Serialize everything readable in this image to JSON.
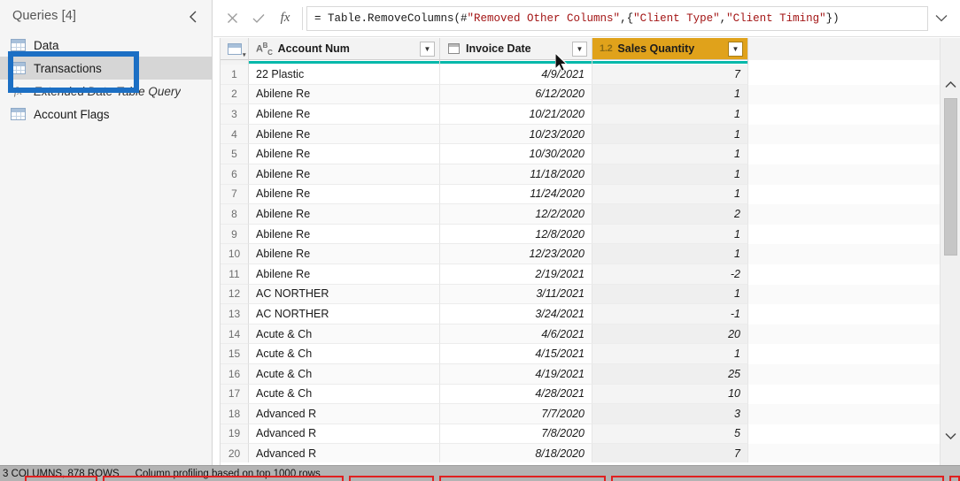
{
  "sidebar": {
    "title": "Queries [4]",
    "collapse_icon": "chevron-left-icon",
    "items": [
      {
        "label": "Data",
        "icon": "table-icon",
        "italic": false,
        "selected": false
      },
      {
        "label": "Transactions",
        "icon": "table-icon",
        "italic": false,
        "selected": true
      },
      {
        "label": "Extended Date Table Query",
        "icon": "fx-icon",
        "italic": true,
        "selected": false
      },
      {
        "label": "Account Flags",
        "icon": "table-icon",
        "italic": false,
        "selected": false
      }
    ]
  },
  "formula_bar": {
    "cancel_icon": "close-icon",
    "commit_icon": "check-icon",
    "fx_icon": "fx-icon",
    "expand_icon": "chevron-down-icon",
    "formula_prefix": "= Table.RemoveColumns(#",
    "formula_str1": "\"Removed Other Columns\"",
    "formula_mid": ",{",
    "formula_str2": "\"Client Type\"",
    "formula_comma": ", ",
    "formula_str3": "\"Client Timing\"",
    "formula_suffix": "})",
    "formula_full": "= Table.RemoveColumns(#\"Removed Other Columns\",{\"Client Type\", \"Client Timing\"})"
  },
  "grid": {
    "corner_icon": "table-select-all-icon",
    "columns": [
      {
        "name": "Account Num",
        "type_icon": "abc-text-type-icon",
        "type_label": "ABC",
        "selected": false
      },
      {
        "name": "Invoice Date",
        "type_icon": "calendar-date-type-icon",
        "type_label": "",
        "selected": false
      },
      {
        "name": "Sales Quantity",
        "type_icon": "decimal-number-type-icon",
        "type_label": "1.2",
        "selected": true
      }
    ],
    "filter_icon": "chevron-down-icon",
    "quality_bar_color": "#01b8aa",
    "selected_header_color": "#e0a21b",
    "rows": [
      {
        "n": "1",
        "account": "22 Plastic",
        "date": "4/9/2021",
        "qty": "7"
      },
      {
        "n": "2",
        "account": "Abilene Re",
        "date": "6/12/2020",
        "qty": "1"
      },
      {
        "n": "3",
        "account": "Abilene Re",
        "date": "10/21/2020",
        "qty": "1"
      },
      {
        "n": "4",
        "account": "Abilene Re",
        "date": "10/23/2020",
        "qty": "1"
      },
      {
        "n": "5",
        "account": "Abilene Re",
        "date": "10/30/2020",
        "qty": "1"
      },
      {
        "n": "6",
        "account": "Abilene Re",
        "date": "11/18/2020",
        "qty": "1"
      },
      {
        "n": "7",
        "account": "Abilene Re",
        "date": "11/24/2020",
        "qty": "1"
      },
      {
        "n": "8",
        "account": "Abilene Re",
        "date": "12/2/2020",
        "qty": "2"
      },
      {
        "n": "9",
        "account": "Abilene Re",
        "date": "12/8/2020",
        "qty": "1"
      },
      {
        "n": "10",
        "account": "Abilene Re",
        "date": "12/23/2020",
        "qty": "1"
      },
      {
        "n": "11",
        "account": "Abilene Re",
        "date": "2/19/2021",
        "qty": "-2"
      },
      {
        "n": "12",
        "account": "AC NORTHER",
        "date": "3/11/2021",
        "qty": "1"
      },
      {
        "n": "13",
        "account": "AC NORTHER",
        "date": "3/24/2021",
        "qty": "-1"
      },
      {
        "n": "14",
        "account": "Acute & Ch",
        "date": "4/6/2021",
        "qty": "20"
      },
      {
        "n": "15",
        "account": "Acute & Ch",
        "date": "4/15/2021",
        "qty": "1"
      },
      {
        "n": "16",
        "account": "Acute & Ch",
        "date": "4/19/2021",
        "qty": "25"
      },
      {
        "n": "17",
        "account": "Acute & Ch",
        "date": "4/28/2021",
        "qty": "10"
      },
      {
        "n": "18",
        "account": "Advanced R",
        "date": "7/7/2020",
        "qty": "3"
      },
      {
        "n": "19",
        "account": "Advanced R",
        "date": "7/8/2020",
        "qty": "5"
      },
      {
        "n": "20",
        "account": "Advanced R",
        "date": "8/18/2020",
        "qty": "7"
      }
    ]
  },
  "scrollbar": {
    "up_icon": "chevron-up-icon",
    "down_icon": "chevron-down-icon"
  },
  "status_bar": {
    "columns_rows": "3 COLUMNS, 878 ROWS",
    "profiling": "Column profiling based on top 1000 rows"
  },
  "annotations": {
    "highlight_color": "#1c6fc4",
    "marker_color": "#e02020",
    "cursor_icon": "mouse-pointer-icon"
  }
}
